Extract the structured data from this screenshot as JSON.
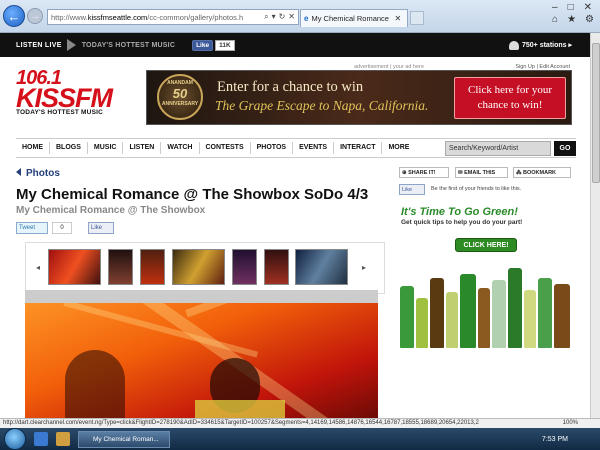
{
  "browser": {
    "url_prefix": "http://www.",
    "url_domain": "kissfmseattle.com",
    "url_rest": "/cc-common/gallery/photos.h",
    "tab_title": "My Chemical Romance @ ...",
    "controls": [
      "search-icon",
      "lock-icon",
      "refresh-icon",
      "stop-icon"
    ],
    "right_icons": [
      "home-icon",
      "favorites-icon",
      "tools-icon"
    ]
  },
  "topbar": {
    "listen_live": "LISTEN LIVE",
    "hottest": "TODAY'S HOTTEST MUSIC",
    "like_label": "Like",
    "like_count": "11K",
    "stations": "750+ stations ▸"
  },
  "header": {
    "ad_label": "advertisement | your ad here",
    "sign_in": "Sign Up | Edit Account",
    "logo_freq": "106.1",
    "logo_name": "KISSFM",
    "logo_tagline": "TODAY'S HOTTEST MUSIC"
  },
  "banner": {
    "seal_top": "ANANDAM",
    "seal_num": "50",
    "seal_bottom": "ANNIVERSARY",
    "line1": "Enter for a chance to win",
    "line2": "The Grape Escape to Napa, California.",
    "cta": "Click here for your chance to win!"
  },
  "nav": {
    "items": [
      "HOME",
      "BLOGS",
      "MUSIC",
      "LISTEN",
      "WATCH",
      "CONTESTS",
      "PHOTOS",
      "EVENTS",
      "INTERACT",
      "MORE"
    ],
    "search_placeholder": "Search/Keyword/Artist",
    "go": "GO"
  },
  "article": {
    "breadcrumb": "Photos",
    "title": "My Chemical Romance @ The Showbox SoDo 4/3",
    "subtitle": "My Chemical Romance @ The Showbox",
    "tweet": "Tweet",
    "tweet_count": "0",
    "like": "Like"
  },
  "sidebar": {
    "share": "SHARE IT!",
    "email": "EMAIL THIS",
    "bookmark": "BOOKMARK",
    "like": "Like",
    "friends": "Be the first of your friends to like this.",
    "green_head": "It's Time To Go Green!",
    "green_sub": "Get quick tips to help you do your part!",
    "green_btn": "CLICK HERE!"
  },
  "status": {
    "url": "http://dart.clearchannel.com/event.ng/Type=click&FlightID=278190&AdID=334615&TargetID=100257&Segments=4,14169,14586,14876,16544,16787,18555,18689,20654,22013,2",
    "zoom": "100%"
  },
  "taskbar": {
    "task": "My Chemical Roman...",
    "clock": "7:53 PM"
  }
}
